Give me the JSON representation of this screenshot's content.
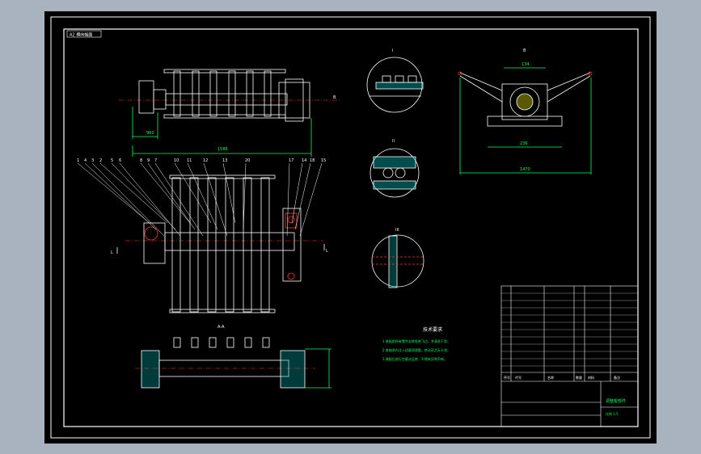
{
  "viewer": {
    "background": "#a9b3c0",
    "canvas_bg": "#000000"
  },
  "sheet": {
    "stamp": "A2 横向幅面",
    "line_color": "#ffffff",
    "dim_color": "#00ff66",
    "center_color": "#ff3333",
    "hatch_color": "#00dddd"
  },
  "labels": {
    "top_dim_left": "960",
    "top_dim_overall": "1586",
    "section_a": "A-A",
    "view_i": "I",
    "view_ii": "II",
    "view_iii": "III",
    "view_b": "B",
    "b_dim_top": "134",
    "b_dim_mid": "236",
    "b_dim_overall": "1470",
    "end_mark_right": "B",
    "side_mark_left": "L",
    "side_mark_right": "L"
  },
  "balloons": [
    "1",
    "4",
    "3",
    "2",
    "5",
    "6",
    "8",
    "9",
    "7",
    "10",
    "11",
    "12",
    "13",
    "20",
    "17",
    "14",
    "18",
    "15"
  ],
  "notes": {
    "title": "技术要求",
    "lines": [
      "1.装配前所有零件去除毛刺飞边，并清洗干净；",
      "2.各轴承内注入适量润滑脂，转动灵活无卡滞；",
      "3.装配后进行空载试运转，不得有异常声响。"
    ]
  },
  "titleblock": {
    "drawing_name": "调整辊部件",
    "scale_text": "比例 1:5",
    "header": [
      "序号",
      "代号",
      "名称",
      "数量",
      "材料",
      "备注"
    ]
  }
}
